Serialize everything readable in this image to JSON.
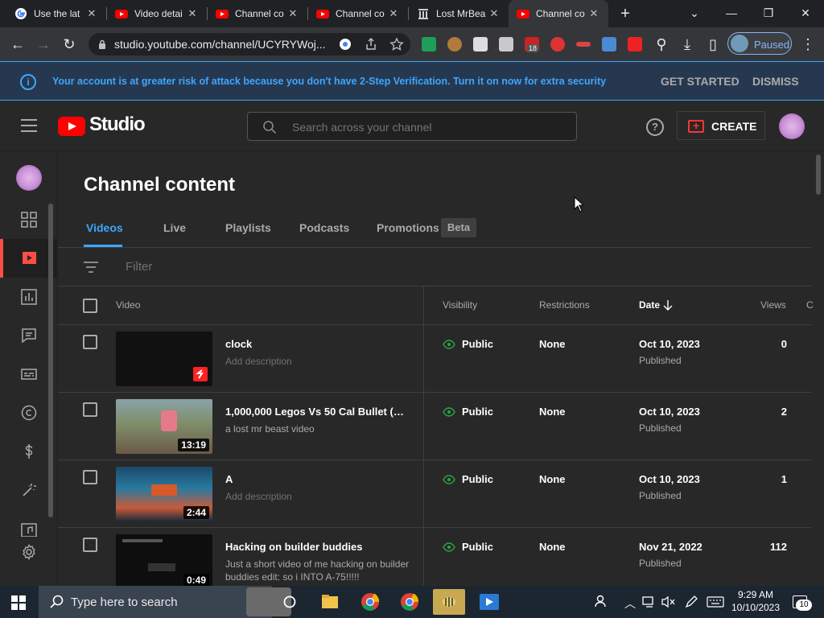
{
  "browser": {
    "tabs": [
      {
        "title": "Use the lat",
        "favicon": "google-icon",
        "active": false
      },
      {
        "title": "Video detai",
        "favicon": "youtube-icon",
        "active": false
      },
      {
        "title": "Channel co",
        "favicon": "youtube-icon",
        "active": false
      },
      {
        "title": "Channel co",
        "favicon": "youtube-icon",
        "active": false
      },
      {
        "title": "Lost MrBea",
        "favicon": "archive-icon",
        "active": false
      },
      {
        "title": "Channel co",
        "favicon": "youtube-icon",
        "active": true
      }
    ],
    "url": "studio.youtube.com/channel/UCYRYWoj...",
    "profile_label": "Paused",
    "extension_badge": "18"
  },
  "banner": {
    "message": "Your account is at greater risk of attack because you don't have 2-Step Verification. Turn it on now for extra security",
    "get_started": "GET STARTED",
    "dismiss": "DISMISS"
  },
  "header": {
    "logo_text": "Studio",
    "search_placeholder": "Search across your channel",
    "help": "?",
    "create_label": "CREATE"
  },
  "page": {
    "title": "Channel content",
    "tabs": [
      {
        "label": "Videos",
        "active": true
      },
      {
        "label": "Live",
        "active": false
      },
      {
        "label": "Playlists",
        "active": false
      },
      {
        "label": "Podcasts",
        "active": false
      },
      {
        "label": "Promotions",
        "active": false
      }
    ],
    "beta_badge": "Beta",
    "filter_placeholder": "Filter"
  },
  "table": {
    "columns": {
      "video": "Video",
      "visibility": "Visibility",
      "restrictions": "Restrictions",
      "date": "Date",
      "views": "Views",
      "comments": "C"
    },
    "rows": [
      {
        "title": "clock",
        "description": "Add description",
        "description_placeholder": true,
        "duration": "",
        "visibility": "Public",
        "restrictions": "None",
        "date": "Oct 10, 2023",
        "status": "Published",
        "views": "0"
      },
      {
        "title": "1,000,000 Legos Vs 50 Cal Bullet (Mr ...",
        "description": "a lost mr beast video",
        "description_placeholder": false,
        "duration": "13:19",
        "visibility": "Public",
        "restrictions": "None",
        "date": "Oct 10, 2023",
        "status": "Published",
        "views": "2"
      },
      {
        "title": "A",
        "description": "Add description",
        "description_placeholder": true,
        "duration": "2:44",
        "visibility": "Public",
        "restrictions": "None",
        "date": "Oct 10, 2023",
        "status": "Published",
        "views": "1"
      },
      {
        "title": "Hacking on builder buddies",
        "description": "Just a short video of me hacking on builder buddies edit: so i INTO A-75!!!!!",
        "description_placeholder": false,
        "duration": "0:49",
        "visibility": "Public",
        "restrictions": "None",
        "date": "Nov 21, 2022",
        "status": "Published",
        "views": "112"
      }
    ]
  },
  "taskbar": {
    "search_placeholder": "Type here to search",
    "time": "9:29 AM",
    "date": "10/10/2023",
    "notifications": "10"
  },
  "colors": {
    "accent_blue": "#3ea6ff",
    "youtube_red": "#ff0000",
    "background": "#282828"
  }
}
